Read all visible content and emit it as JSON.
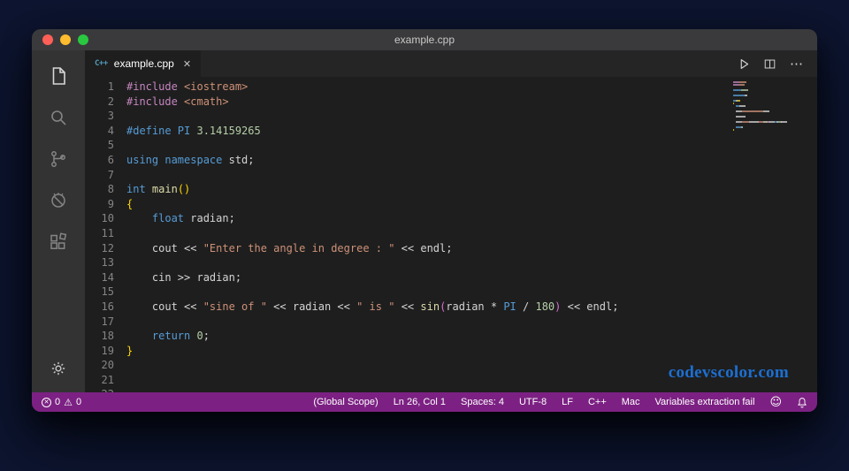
{
  "window": {
    "title": "example.cpp"
  },
  "activity_bar": {
    "icons": [
      "explorer",
      "search",
      "source-control",
      "run-and-debug",
      "extensions",
      "settings-gear"
    ]
  },
  "tab": {
    "icon": "C++",
    "label": "example.cpp",
    "close_glyph": "✕"
  },
  "toolbar": {
    "run": "run",
    "split": "split-editor",
    "more_glyph": "⋯"
  },
  "editor": {
    "watermark": "codevscolor.com",
    "lines": [
      [
        [
          "pp",
          "#include "
        ],
        [
          "str",
          "<iostream>"
        ]
      ],
      [
        [
          "pp",
          "#include "
        ],
        [
          "str",
          "<cmath>"
        ]
      ],
      [],
      [
        [
          "kw",
          "#define PI "
        ],
        [
          "num",
          "3.14159265"
        ]
      ],
      [],
      [
        [
          "kw",
          "using namespace "
        ],
        [
          "pl",
          "std;"
        ]
      ],
      [],
      [
        [
          "kw",
          "int "
        ],
        [
          "fn",
          "main"
        ],
        [
          "br1",
          "()"
        ]
      ],
      [
        [
          "br1",
          "{"
        ]
      ],
      [
        [
          "pl",
          "    "
        ],
        [
          "kw",
          "float"
        ],
        [
          "pl",
          " radian;"
        ]
      ],
      [],
      [
        [
          "pl",
          "    cout << "
        ],
        [
          "str",
          "\"Enter the angle in degree : \""
        ],
        [
          "pl",
          " << endl;"
        ]
      ],
      [],
      [
        [
          "pl",
          "    cin >> radian;"
        ]
      ],
      [],
      [
        [
          "pl",
          "    cout << "
        ],
        [
          "str",
          "\"sine of \""
        ],
        [
          "pl",
          " << radian << "
        ],
        [
          "str",
          "\" is \""
        ],
        [
          "pl",
          " << "
        ],
        [
          "fn",
          "sin"
        ],
        [
          "br2",
          "("
        ],
        [
          "pl",
          "radian * "
        ],
        [
          "kw",
          "PI"
        ],
        [
          "pl",
          " / "
        ],
        [
          "num",
          "180"
        ],
        [
          "br2",
          ")"
        ],
        [
          "pl",
          " << endl;"
        ]
      ],
      [],
      [
        [
          "pl",
          "    "
        ],
        [
          "kw",
          "return "
        ],
        [
          "num",
          "0"
        ],
        [
          "pl",
          ";"
        ]
      ],
      [
        [
          "br1",
          "}"
        ]
      ],
      [],
      [],
      []
    ]
  },
  "status_bar": {
    "error_glyph": "✕",
    "error_count": "0",
    "warning_glyph": "⚠",
    "warning_count": "0",
    "items": [
      "(Global Scope)",
      "Ln 26, Col 1",
      "Spaces: 4",
      "UTF-8",
      "LF",
      "C++",
      "Mac",
      "Variables extraction fail"
    ],
    "smiley_glyph": "☺"
  },
  "colors": {
    "status_bar_bg": "#7c2183",
    "watermark": "#1d6fd1",
    "editor_bg": "#1e1e1e",
    "activity_bar_bg": "#333333",
    "titlebar_bg": "#3a3a3c",
    "tokens": {
      "pp": "#C586C0",
      "str": "#CE9178",
      "kw": "#569CD6",
      "fn": "#DCDCAA",
      "num": "#B5CEA8",
      "pl": "#D4D4D4",
      "br1": "#FFD700",
      "br2": "#DA70D6"
    }
  }
}
